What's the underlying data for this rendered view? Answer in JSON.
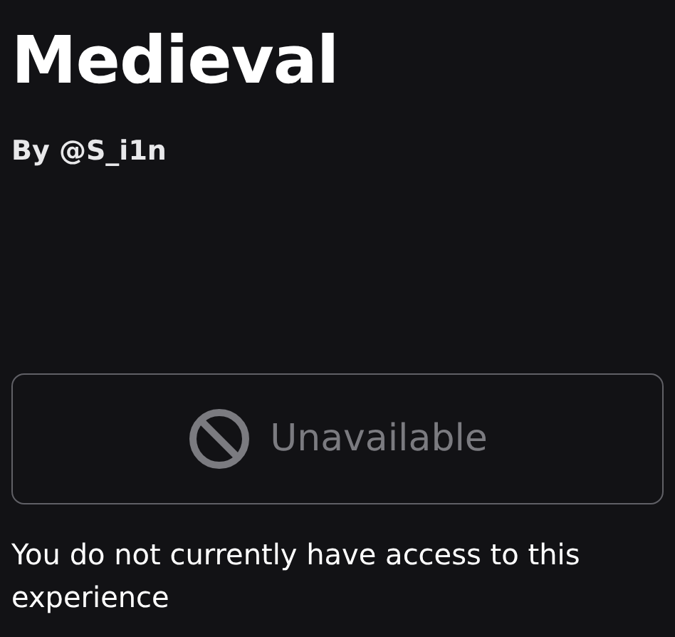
{
  "title": "Medieval",
  "byline": {
    "prefix": "By",
    "creator": "@S_i1n"
  },
  "play_button": {
    "label": "Unavailable",
    "disabled": true
  },
  "message": "You do not currently have access to this experience"
}
